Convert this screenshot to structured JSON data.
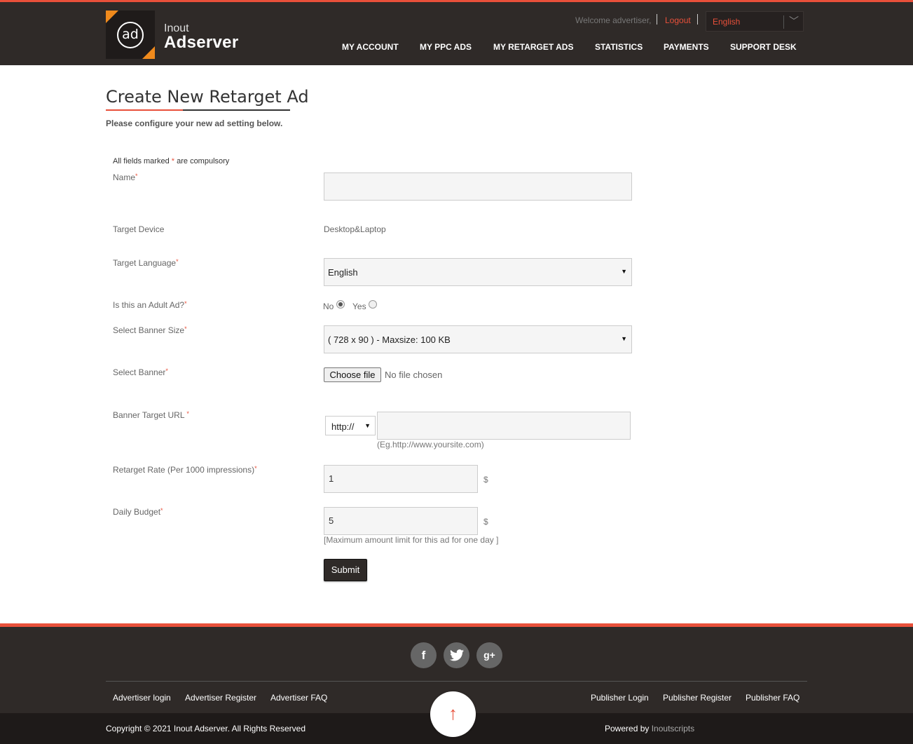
{
  "header": {
    "logo_mark": "ad",
    "logo_line1": "Inout",
    "logo_line2": "Adserver",
    "welcome": "Welcome advertiser,",
    "logout": "Logout",
    "language": "English",
    "nav": [
      "MY ACCOUNT",
      "MY PPC ADS",
      "MY RETARGET ADS",
      "STATISTICS",
      "PAYMENTS",
      "SUPPORT DESK"
    ]
  },
  "main": {
    "title": "Create New Retarget Ad",
    "subtitle": "Please configure your new ad setting below.",
    "note_prefix": "All fields marked",
    "note_star": "*",
    "note_suffix": "are compulsory",
    "fields": {
      "name_label": "Name",
      "name_value": "",
      "device_label": "Target Device",
      "device_value": "Desktop&Laptop",
      "language_label": "Target Language",
      "language_value": "English",
      "adult_label": "Is this an Adult Ad?",
      "adult_no": "No",
      "adult_yes": "Yes",
      "banner_size_label": "Select Banner Size",
      "banner_size_value": "( 728 x 90 ) - Maxsize: 100 KB",
      "banner_label": "Select Banner",
      "file_button": "Choose file",
      "file_status": "No file chosen",
      "url_label": "Banner Target URL",
      "url_protocol": "http://",
      "url_value": "",
      "url_hint": "(Eg.http://www.yoursite.com)",
      "rate_label": "Retarget Rate (Per 1000 impressions)",
      "rate_value": "1",
      "rate_unit": "$",
      "budget_label": "Daily Budget",
      "budget_value": "5",
      "budget_unit": "$",
      "budget_hint": "[Maximum amount limit for this ad for one day ]",
      "required_mark": "*"
    },
    "submit": "Submit"
  },
  "footer": {
    "social": [
      "f",
      "t",
      "g+"
    ],
    "left_links": [
      "Advertiser login",
      "Advertiser Register",
      "Advertiser FAQ"
    ],
    "right_links": [
      "Publisher Login",
      "Publisher Register",
      "Publisher FAQ"
    ],
    "copyright": "Copyright © 2021 Inout Adserver. All Rights Reserved",
    "powered_prefix": "Powered by",
    "powered_name": "Inoutscripts",
    "to_top": "↑"
  },
  "colors": {
    "accent": "#e8503a",
    "header_bg": "#2f2a28",
    "footer_bottom": "#1e1a19"
  }
}
